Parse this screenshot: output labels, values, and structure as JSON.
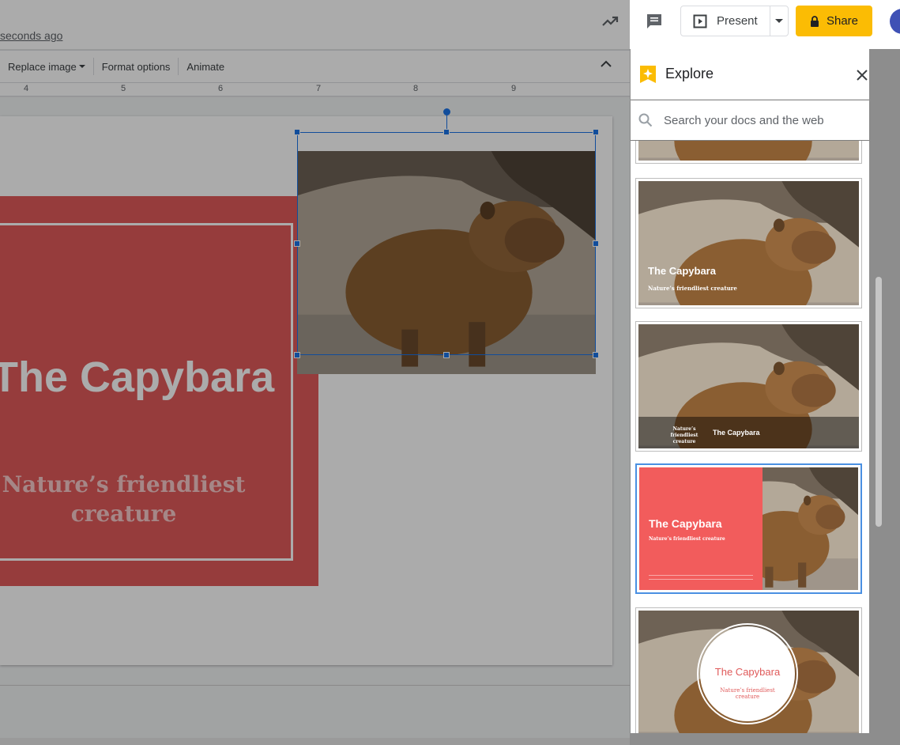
{
  "header": {
    "saved_text": "seconds ago",
    "present_label": "Present",
    "share_label": "Share",
    "colors": {
      "share": "#fbbc04",
      "accent": "#1a73e8"
    }
  },
  "toolbar": {
    "replace_image": "Replace image",
    "format_options": "Format options",
    "animate": "Animate"
  },
  "ruler": {
    "ticks": [
      "4",
      "5",
      "6",
      "7",
      "8",
      "9"
    ]
  },
  "slide": {
    "title": "The Capybara",
    "subtitle_line1": "Nature’s friendliest",
    "subtitle_line2": "creature",
    "colors": {
      "block": "#e05a5a",
      "text": "#ffffff"
    }
  },
  "explore": {
    "title": "Explore",
    "search_placeholder": "Search your docs and the web",
    "layouts": [
      {
        "title": "The Capybara",
        "subtitle": "Nature’s friendliest creature"
      },
      {
        "title": "The Capybara",
        "subtitle_line1": "Nature’s friendliest",
        "subtitle_line2": "creature"
      },
      {
        "title": "The Capybara",
        "subtitle": "Nature’s friendliest creature"
      },
      {
        "title": "The Capybara",
        "subtitle_line1": "Nature’s friendliest",
        "subtitle_line2": "creature"
      }
    ]
  },
  "icons": [
    "trending-icon",
    "comment-icon",
    "present-icon",
    "lock-icon",
    "explore-icon",
    "close-icon",
    "search-icon",
    "collapse-icon"
  ]
}
